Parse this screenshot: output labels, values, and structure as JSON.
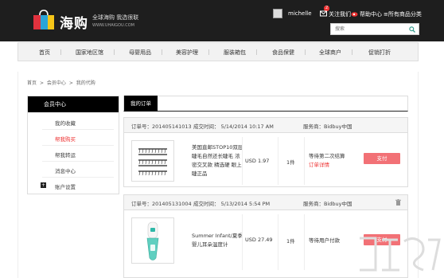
{
  "header": {
    "logo_text": "海购",
    "slogan_main": "全球海购 我选很联",
    "slogan_url": "WWW.UHAIGOU.COM",
    "user_name": "michelle",
    "notif_count": "2",
    "links": [
      "关注我们",
      "帮助中心",
      "≡所有商品分类"
    ]
  },
  "search": {
    "placeholder": "搜索"
  },
  "nav": {
    "items": [
      "首页",
      "国家地区馆",
      "母婴用品",
      "美容护理",
      "服装箱包",
      "食品保健",
      "全球商户",
      "促销打折"
    ]
  },
  "breadcrumb": [
    "首页",
    ">",
    "会员中心",
    ">",
    "我的代购"
  ],
  "sidebar": {
    "header": "会员中心",
    "items": [
      "我的收藏",
      "帮我购买",
      "帮我转运",
      "消息中心",
      "账户设置"
    ],
    "plus": "+"
  },
  "main": {
    "tab": "我的订单",
    "orders": [
      {
        "order_no": "订单号：201405141013",
        "time": "成交时间：  5/14/2014 10:17 AM",
        "service": "服务商：Bidbuy中国",
        "product": "美国直邮STOP10双层睫毛自然还长睫毛 浓密交叉款 精选硬 眼上睫正品",
        "price": "USD 1.97",
        "qty": "1件",
        "status": "等待第二次结算",
        "status_link": "订单详情",
        "button": "支付"
      },
      {
        "order_no": "订单号：201405131004",
        "time": "成交时间：  5/13/2014 5:54 PM",
        "service": "服务商：Bidbuy中国",
        "product": "Summer Infant/夏季婴儿耳朵温度计",
        "price": "USD 27.49",
        "qty": "1件",
        "status": "等待用户付款",
        "status_link": "",
        "button": "支付"
      }
    ]
  },
  "colors": {
    "accent": "#f27176",
    "dark": "#1e1e1e",
    "active_link": "#e33333"
  },
  "icons": [
    "bag-logo-icon",
    "mail-icon",
    "weibo-icon",
    "help-icon",
    "search-icon",
    "trash-icon"
  ]
}
